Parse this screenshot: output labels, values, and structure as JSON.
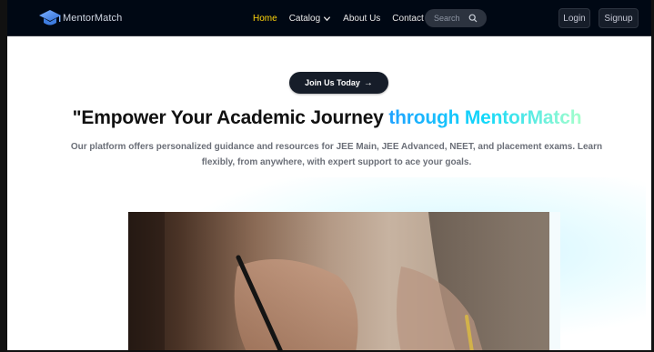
{
  "brand": {
    "name": "MentorMatch",
    "logo_icon": "graduation-cap-icon"
  },
  "nav": {
    "links": [
      {
        "label": "Home",
        "active": true
      },
      {
        "label": "Catalog",
        "has_dropdown": true
      },
      {
        "label": "About Us"
      },
      {
        "label": "Contact Us"
      }
    ],
    "search_placeholder": "Search",
    "login_label": "Login",
    "signup_label": "Signup"
  },
  "hero": {
    "cta_label": "Join Us Today",
    "cta_icon": "→",
    "headline_prefix": "\"Empower Your Academic Journey ",
    "headline_highlight": "through MentorMatch",
    "description": "Our platform offers personalized guidance and resources for JEE Main, JEE Advanced, NEET, and placement exams. Learn flexibly, from anywhere, with expert support to ace your goals.",
    "image_icon": "student-writing-photo"
  },
  "colors": {
    "navbar_bg": "#000814",
    "active_link": "#ffd60a",
    "accent_gradient": [
      "#1fa2ff",
      "#12d8fa",
      "#a6ffcb"
    ],
    "cta_bg": "#161d29"
  }
}
